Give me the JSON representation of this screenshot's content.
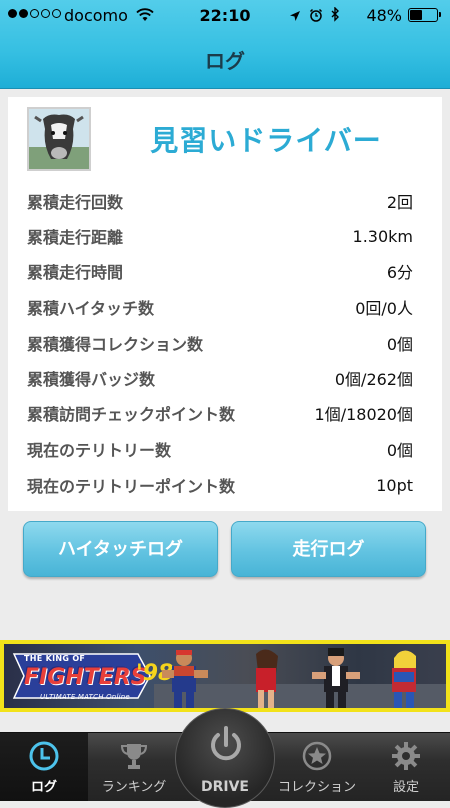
{
  "status_bar": {
    "carrier": "docomo",
    "time": "22:10",
    "battery_percent_text": "48%",
    "battery_level": 0.48
  },
  "nav": {
    "title": "ログ"
  },
  "profile": {
    "rank_title": "見習いドライバー",
    "avatar_icon": "cow-avatar"
  },
  "stats": [
    {
      "label": "累積走行回数",
      "value": "2回"
    },
    {
      "label": "累積走行距離",
      "value": "1.30km"
    },
    {
      "label": "累積走行時間",
      "value": "6分"
    },
    {
      "label": "累積ハイタッチ数",
      "value": "0回/0人"
    },
    {
      "label": "累積獲得コレクション数",
      "value": "0個"
    },
    {
      "label": "累積獲得バッジ数",
      "value": "0個/262個"
    },
    {
      "label": "累積訪問チェックポイント数",
      "value": "1個/18020個"
    },
    {
      "label": "現在のテリトリー数",
      "value": "0個"
    },
    {
      "label": "現在のテリトリーポイント数",
      "value": "10pt"
    }
  ],
  "buttons": {
    "hightouch_log": "ハイタッチログ",
    "drive_log": "走行ログ"
  },
  "banner": {
    "tag": "THE KING OF",
    "word": "FIGHTERS",
    "number": "'98",
    "subtitle": "ULTIMATE MATCH Online"
  },
  "tabs": {
    "log": "ログ",
    "ranking": "ランキング",
    "drive": "DRIVE",
    "collection": "コレクション",
    "settings": "設定"
  },
  "colors": {
    "header_blue": "#35bfe2",
    "accent_title": "#2cabd4",
    "button_blue": "#62c3e1",
    "banner_yellow": "#f2e21a",
    "tab_active_icon": "#4dc3ec"
  }
}
